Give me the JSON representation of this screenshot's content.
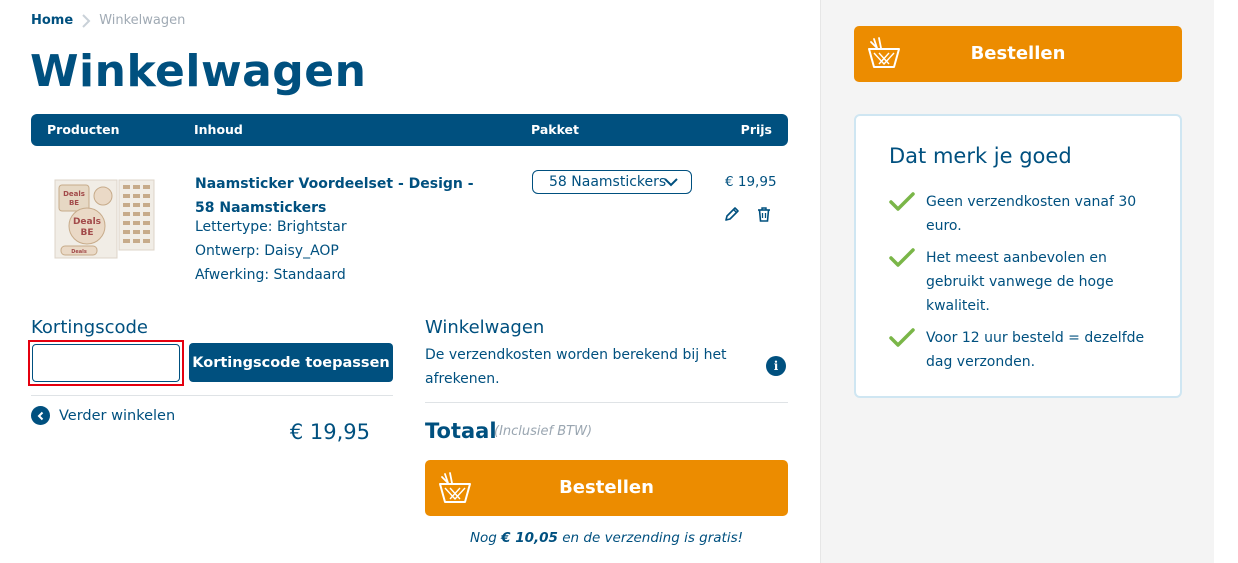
{
  "breadcrumb": {
    "home": "Home",
    "current": "Winkelwagen"
  },
  "page": {
    "title": "Winkelwagen"
  },
  "table": {
    "headers": {
      "products": "Producten",
      "content": "Inhoud",
      "package": "Pakket",
      "price": "Prijs"
    }
  },
  "item": {
    "name": "Naamsticker Voordeelset - Design - 58 Naamstickers",
    "font_line": "Lettertype: Brightstar",
    "design_line": "Ontwerp: Daisy_AOP",
    "finish_line": "Afwerking: Standaard",
    "package": "58 Naamstickers",
    "price": "€ 19,95",
    "thumb_text_1": "Deals",
    "thumb_text_2": "BE",
    "thumb_text_3": "Deals",
    "thumb_text_4": "BE",
    "thumb_text_5": "Deals"
  },
  "coupon": {
    "title": "Kortingscode",
    "input_value": "",
    "button": "Kortingscode toepassen",
    "continue": "Verder winkelen"
  },
  "summary": {
    "title": "Winkelwagen",
    "shipping_text": "De verzendkosten worden berekend bij het afrekenen.",
    "total_label": "Totaal",
    "total_vat": "(Inclusief BTW)",
    "total_amount": "€ 19,95",
    "order_button": "Bestellen",
    "free_shipping_prefix": "Nog ",
    "free_shipping_amount": "€ 10,05",
    "free_shipping_suffix": " en de verzending is gratis!"
  },
  "sidebar": {
    "order_button": "Bestellen",
    "usp_title": "Dat merk je goed",
    "usps": [
      "Geen verzendkosten vanaf 30 euro.",
      "Het meest aanbevolen en gebruikt vanwege de hoge kwaliteit.",
      "Voor 12 uur besteld = dezelfde dag verzonden."
    ]
  },
  "colors": {
    "brand": "#00507f",
    "accent": "#ec8c00",
    "check": "#7ab648",
    "highlight": "#e4000f"
  },
  "icons": [
    "chevron-right-icon",
    "chevron-down-icon",
    "pencil-icon",
    "trash-icon",
    "chevron-left-icon",
    "info-icon",
    "basket-icon",
    "check-icon"
  ]
}
